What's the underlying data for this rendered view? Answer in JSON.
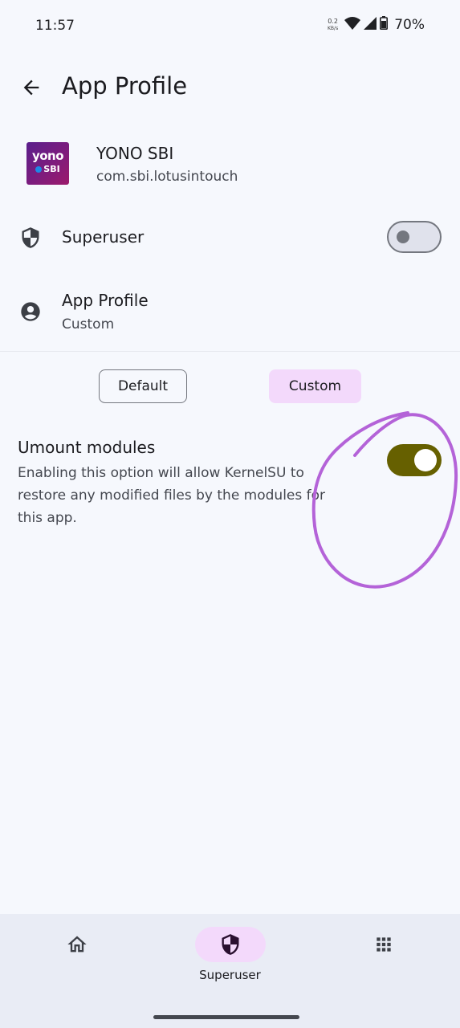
{
  "status_bar": {
    "time": "11:57",
    "net_speed": "0.2",
    "net_unit": "KB/s",
    "battery": "70%"
  },
  "top_bar": {
    "title": "App Profile"
  },
  "app": {
    "name": "YONO SBI",
    "package": "com.sbi.lotusintouch",
    "icon_text_top": "yono",
    "icon_text_bottom": "SBI"
  },
  "superuser": {
    "label": "Superuser",
    "enabled": false
  },
  "app_profile": {
    "label": "App Profile",
    "value": "Custom"
  },
  "profile_modes": {
    "default_label": "Default",
    "custom_label": "Custom",
    "selected": "Custom"
  },
  "umount": {
    "title": "Umount modules",
    "description": "Enabling this option will allow KernelSU to restore any modified files by the modules for this app.",
    "enabled": true
  },
  "bottom_nav": {
    "items": [
      {
        "icon": "home-icon",
        "label": ""
      },
      {
        "icon": "shield-icon",
        "label": "Superuser"
      },
      {
        "icon": "grid-icon",
        "label": ""
      }
    ],
    "selected": "Superuser"
  },
  "colors": {
    "background": "#f6f8fd",
    "accent_container": "#f3d9fb",
    "switch_on": "#666000",
    "annotation": "#b463d8"
  }
}
